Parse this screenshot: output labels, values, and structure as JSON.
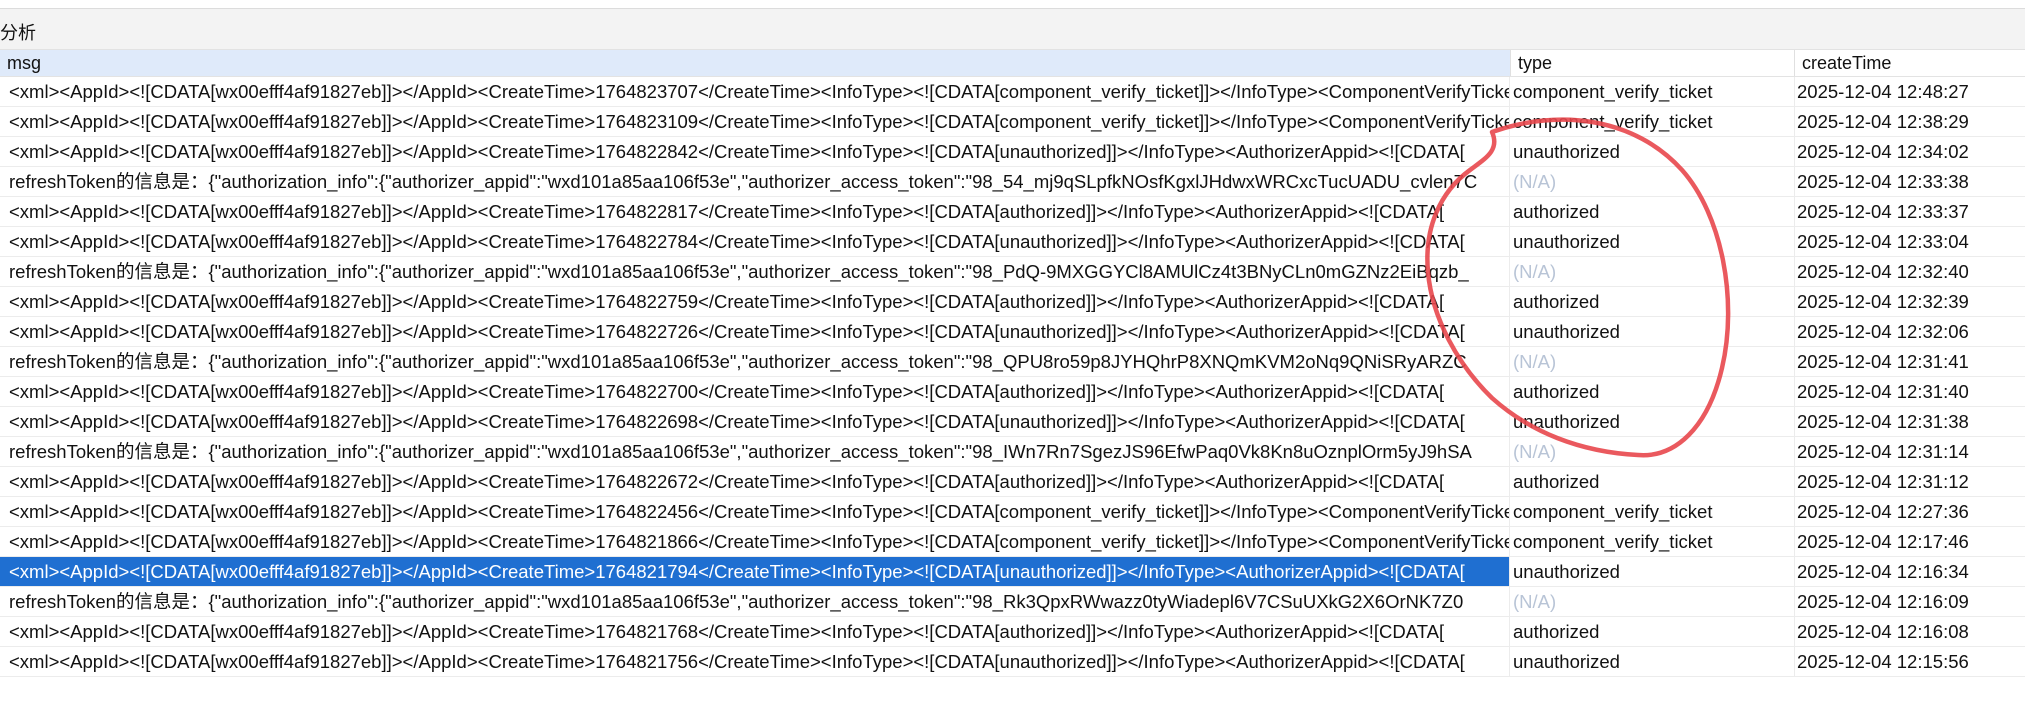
{
  "window": {
    "title": "分析"
  },
  "columns": {
    "msg": "msg",
    "type": "type",
    "createTime": "createTime"
  },
  "rows": [
    {
      "msg": "<xml><AppId><![CDATA[wx00efff4af91827eb]]></AppId><CreateTime>1764823707</CreateTime><InfoType><![CDATA[component_verify_ticket]]></InfoType><ComponentVerifyTicket>",
      "type": "component_verify_ticket",
      "createTime": "2025-12-04 12:48:27"
    },
    {
      "msg": "<xml><AppId><![CDATA[wx00efff4af91827eb]]></AppId><CreateTime>1764823109</CreateTime><InfoType><![CDATA[component_verify_ticket]]></InfoType><ComponentVerifyTicket>",
      "type": "component_verify_ticket",
      "createTime": "2025-12-04 12:38:29"
    },
    {
      "msg": "<xml><AppId><![CDATA[wx00efff4af91827eb]]></AppId><CreateTime>1764822842</CreateTime><InfoType><![CDATA[unauthorized]]></InfoType><AuthorizerAppid><![CDATA[",
      "type": "unauthorized",
      "createTime": "2025-12-04 12:34:02"
    },
    {
      "msg": "refreshToken的信息是：{\"authorization_info\":{\"authorizer_appid\":\"wxd101a85aa106f53e\",\"authorizer_access_token\":\"98_54_mj9qSLpfkNOsfKgxlJHdwxWRCxcTucUADU_cvlen7C",
      "type": "(N/A)",
      "na": true,
      "createTime": "2025-12-04 12:33:38"
    },
    {
      "msg": "<xml><AppId><![CDATA[wx00efff4af91827eb]]></AppId><CreateTime>1764822817</CreateTime><InfoType><![CDATA[authorized]]></InfoType><AuthorizerAppid><![CDATA[",
      "type": "authorized",
      "createTime": "2025-12-04 12:33:37"
    },
    {
      "msg": "<xml><AppId><![CDATA[wx00efff4af91827eb]]></AppId><CreateTime>1764822784</CreateTime><InfoType><![CDATA[unauthorized]]></InfoType><AuthorizerAppid><![CDATA[",
      "type": "unauthorized",
      "createTime": "2025-12-04 12:33:04"
    },
    {
      "msg": "refreshToken的信息是：{\"authorization_info\":{\"authorizer_appid\":\"wxd101a85aa106f53e\",\"authorizer_access_token\":\"98_PdQ-9MXGGYCl8AMUlCz4t3BNyCLn0mGZNz2EiBqzb_",
      "type": "(N/A)",
      "na": true,
      "createTime": "2025-12-04 12:32:40"
    },
    {
      "msg": "<xml><AppId><![CDATA[wx00efff4af91827eb]]></AppId><CreateTime>1764822759</CreateTime><InfoType><![CDATA[authorized]]></InfoType><AuthorizerAppid><![CDATA[",
      "type": "authorized",
      "createTime": "2025-12-04 12:32:39"
    },
    {
      "msg": "<xml><AppId><![CDATA[wx00efff4af91827eb]]></AppId><CreateTime>1764822726</CreateTime><InfoType><![CDATA[unauthorized]]></InfoType><AuthorizerAppid><![CDATA[",
      "type": "unauthorized",
      "createTime": "2025-12-04 12:32:06"
    },
    {
      "msg": "refreshToken的信息是：{\"authorization_info\":{\"authorizer_appid\":\"wxd101a85aa106f53e\",\"authorizer_access_token\":\"98_QPU8ro59p8JYHQhrP8XNQmKVM2oNq9QNiSRyARZC",
      "type": "(N/A)",
      "na": true,
      "createTime": "2025-12-04 12:31:41"
    },
    {
      "msg": "<xml><AppId><![CDATA[wx00efff4af91827eb]]></AppId><CreateTime>1764822700</CreateTime><InfoType><![CDATA[authorized]]></InfoType><AuthorizerAppid><![CDATA[",
      "type": "authorized",
      "createTime": "2025-12-04 12:31:40"
    },
    {
      "msg": "<xml><AppId><![CDATA[wx00efff4af91827eb]]></AppId><CreateTime>1764822698</CreateTime><InfoType><![CDATA[unauthorized]]></InfoType><AuthorizerAppid><![CDATA[",
      "type": "unauthorized",
      "createTime": "2025-12-04 12:31:38"
    },
    {
      "msg": "refreshToken的信息是：{\"authorization_info\":{\"authorizer_appid\":\"wxd101a85aa106f53e\",\"authorizer_access_token\":\"98_IWn7Rn7SgezJS96EfwPaq0Vk8Kn8uOznplOrm5yJ9hSA",
      "type": "(N/A)",
      "na": true,
      "createTime": "2025-12-04 12:31:14"
    },
    {
      "msg": "<xml><AppId><![CDATA[wx00efff4af91827eb]]></AppId><CreateTime>1764822672</CreateTime><InfoType><![CDATA[authorized]]></InfoType><AuthorizerAppid><![CDATA[",
      "type": "authorized",
      "createTime": "2025-12-04 12:31:12"
    },
    {
      "msg": "<xml><AppId><![CDATA[wx00efff4af91827eb]]></AppId><CreateTime>1764822456</CreateTime><InfoType><![CDATA[component_verify_ticket]]></InfoType><ComponentVerifyTicket>",
      "type": "component_verify_ticket",
      "createTime": "2025-12-04 12:27:36"
    },
    {
      "msg": "<xml><AppId><![CDATA[wx00efff4af91827eb]]></AppId><CreateTime>1764821866</CreateTime><InfoType><![CDATA[component_verify_ticket]]></InfoType><ComponentVerifyTicket>",
      "type": "component_verify_ticket",
      "createTime": "2025-12-04 12:17:46"
    },
    {
      "msg": "<xml><AppId><![CDATA[wx00efff4af91827eb]]></AppId><CreateTime>1764821794</CreateTime><InfoType><![CDATA[unauthorized]]></InfoType><AuthorizerAppid><![CDATA[",
      "type": "unauthorized",
      "createTime": "2025-12-04 12:16:34",
      "selected": true
    },
    {
      "msg": "refreshToken的信息是：{\"authorization_info\":{\"authorizer_appid\":\"wxd101a85aa106f53e\",\"authorizer_access_token\":\"98_Rk3QpxRWwazz0tyWiadepl6V7CSuUXkG2X6OrNK7Z0",
      "type": "(N/A)",
      "na": true,
      "createTime": "2025-12-04 12:16:09"
    },
    {
      "msg": "<xml><AppId><![CDATA[wx00efff4af91827eb]]></AppId><CreateTime>1764821768</CreateTime><InfoType><![CDATA[authorized]]></InfoType><AuthorizerAppid><![CDATA[",
      "type": "authorized",
      "createTime": "2025-12-04 12:16:08"
    },
    {
      "msg": "<xml><AppId><![CDATA[wx00efff4af91827eb]]></AppId><CreateTime>1764821756</CreateTime><InfoType><![CDATA[unauthorized]]></InfoType><AuthorizerAppid><![CDATA[",
      "type": "unauthorized",
      "createTime": "2025-12-04 12:15:56"
    }
  ],
  "colors": {
    "header_msg_bg": "#dfeafa",
    "selection_bg": "#1f6fd1",
    "na_text": "#b8c4d6",
    "annotation_stroke": "#e8474c"
  }
}
